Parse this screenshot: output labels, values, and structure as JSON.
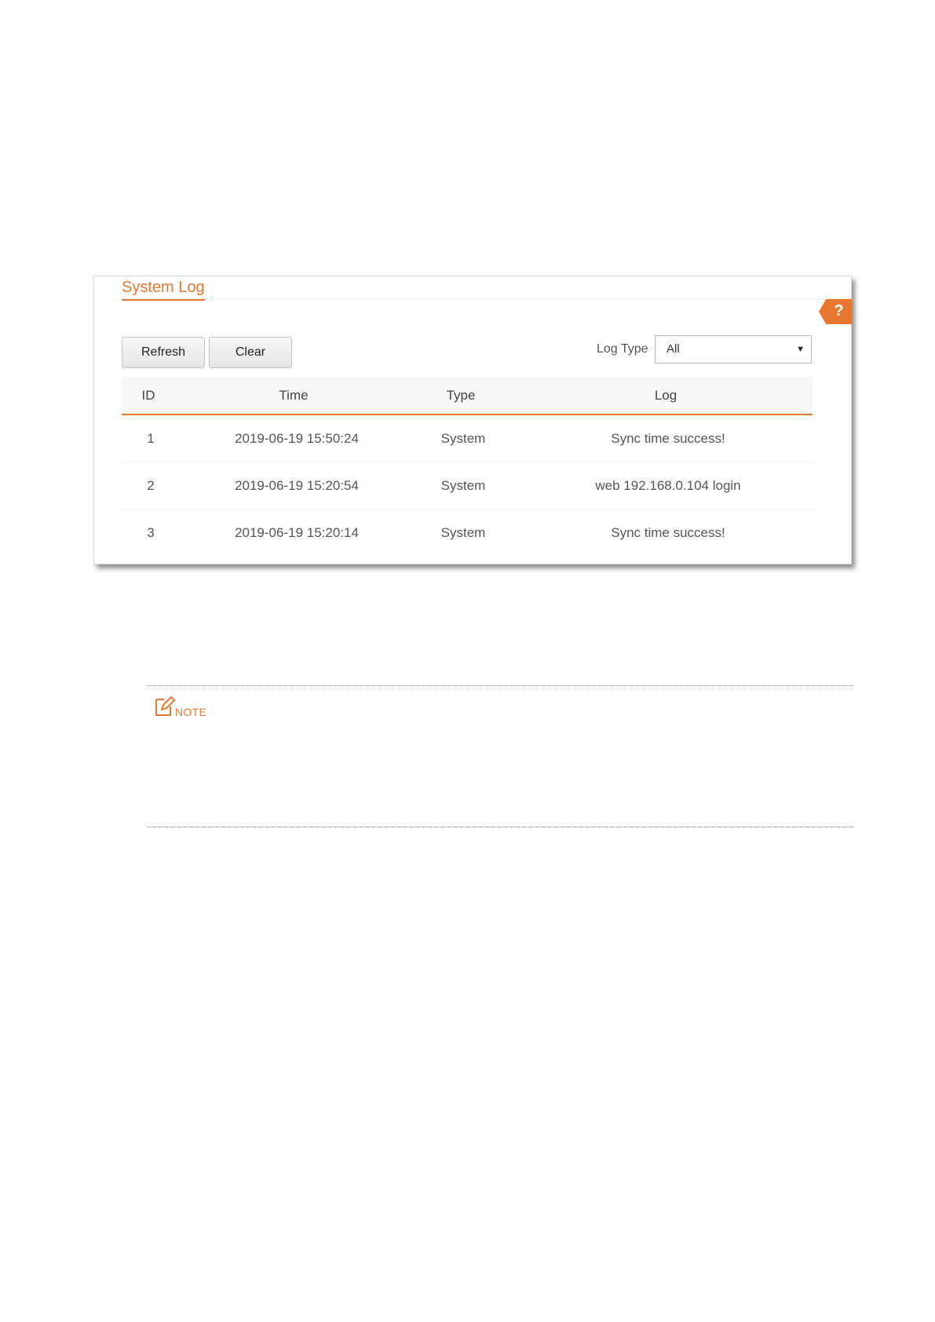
{
  "panel": {
    "title": "System Log",
    "help_label": "?",
    "buttons": {
      "refresh": "Refresh",
      "clear": "Clear"
    },
    "filter": {
      "label": "Log Type",
      "selected": "All"
    },
    "table": {
      "headers": {
        "id": "ID",
        "time": "Time",
        "type": "Type",
        "log": "Log"
      },
      "rows": [
        {
          "id": "1",
          "time": "2019-06-19 15:50:24",
          "type": "System",
          "log": "Sync time success!"
        },
        {
          "id": "2",
          "time": "2019-06-19 15:20:54",
          "type": "System",
          "log": "web 192.168.0.104 login"
        },
        {
          "id": "3",
          "time": "2019-06-19 15:20:14",
          "type": "System",
          "log": "Sync time success!"
        }
      ]
    }
  },
  "note": {
    "label": "NOTE",
    "icon": "note-edit-icon"
  },
  "colors": {
    "accent": "#e8782f",
    "header_bg": "#f8f8f8"
  }
}
